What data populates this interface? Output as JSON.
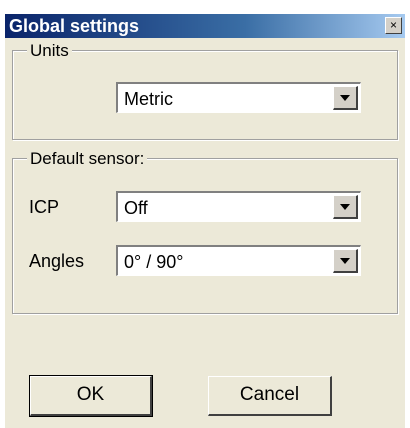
{
  "window": {
    "title": "Global settings",
    "close_glyph": "×"
  },
  "units": {
    "label": "Units",
    "value": "Metric"
  },
  "default_sensor": {
    "label": "Default sensor:",
    "icp_label": "ICP",
    "icp_value": "Off",
    "angles_label": "Angles",
    "angles_value": "0° / 90°"
  },
  "buttons": {
    "ok": "OK",
    "cancel": "Cancel"
  },
  "icons": {
    "close": "close-icon",
    "dropdown": "chevron-down-icon"
  }
}
